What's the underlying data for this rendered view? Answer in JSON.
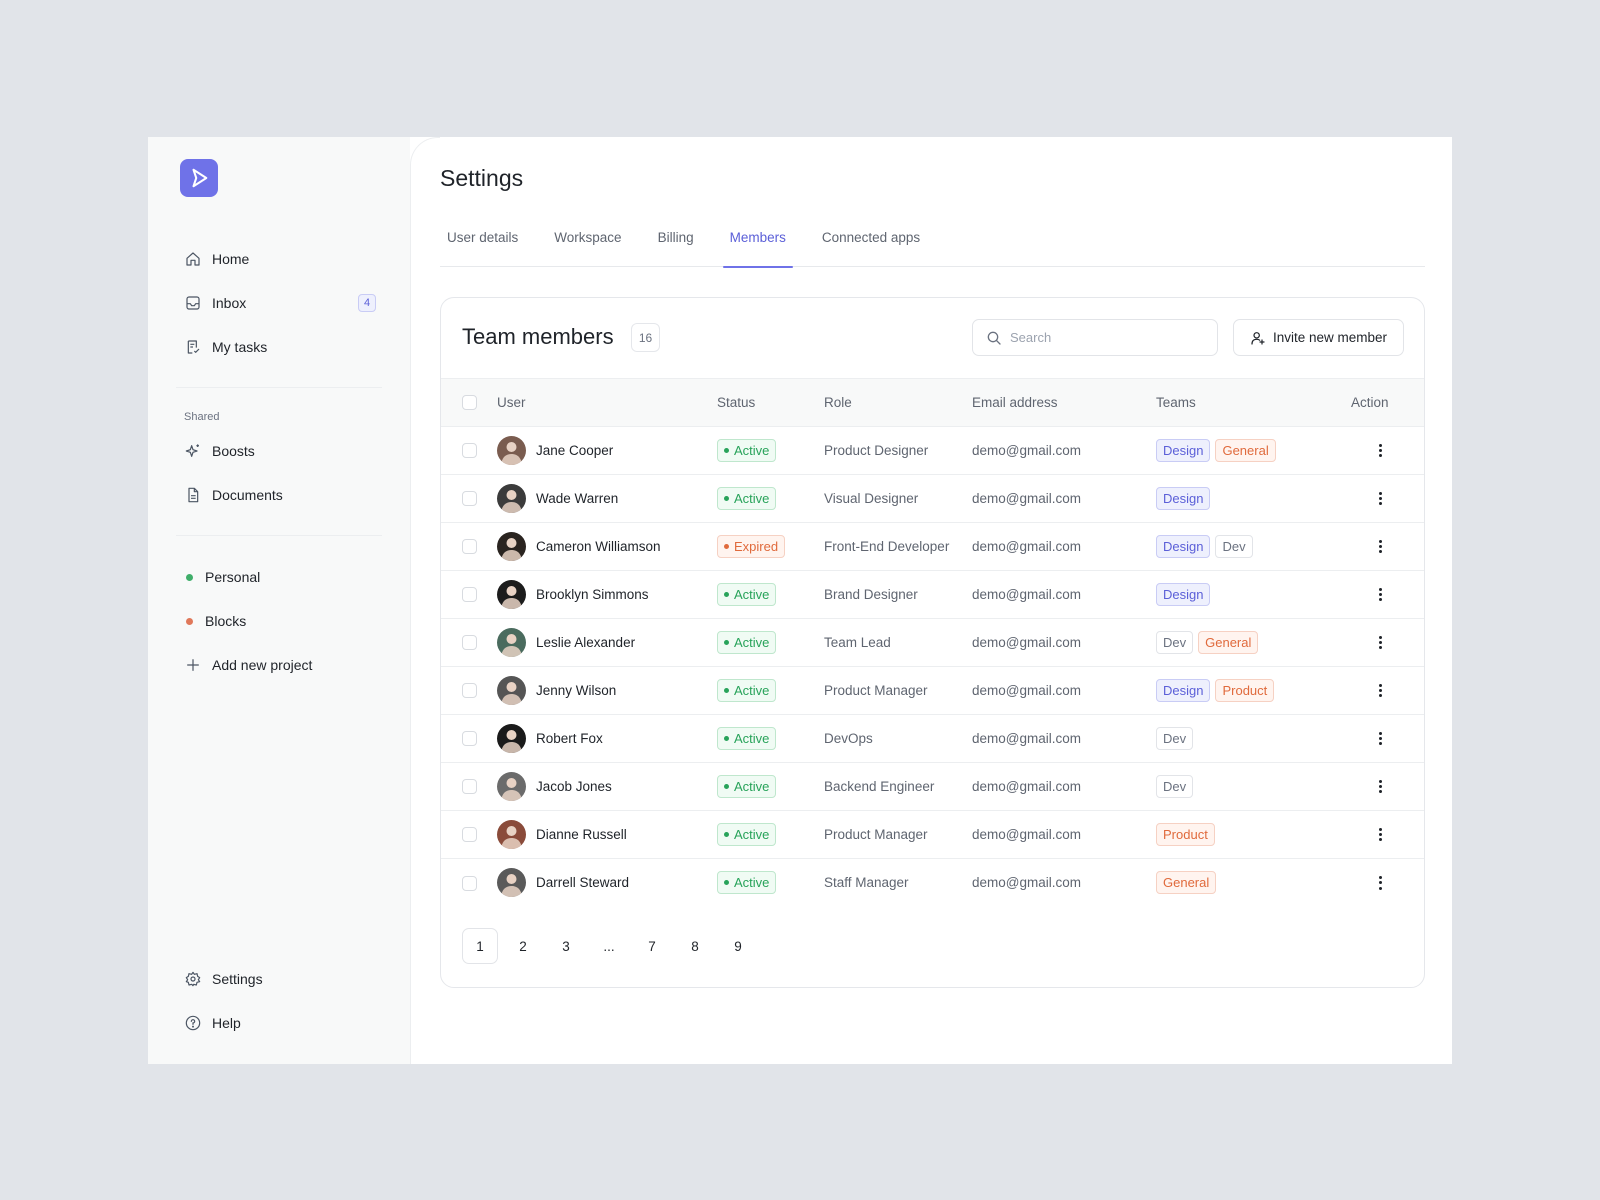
{
  "sidebar": {
    "nav": [
      {
        "label": "Home",
        "icon": "home-icon"
      },
      {
        "label": "Inbox",
        "icon": "inbox-icon",
        "badge": "4"
      },
      {
        "label": "My tasks",
        "icon": "tasks-icon"
      }
    ],
    "shared_label": "Shared",
    "shared": [
      {
        "label": "Boosts",
        "icon": "sparkle-icon"
      },
      {
        "label": "Documents",
        "icon": "document-icon"
      }
    ],
    "projects": [
      {
        "label": "Personal",
        "color": "#3fae6a"
      },
      {
        "label": "Blocks",
        "color": "#e0785a"
      }
    ],
    "add_project": "Add new project",
    "bottom": [
      {
        "label": "Settings",
        "icon": "gear-icon"
      },
      {
        "label": "Help",
        "icon": "help-icon"
      }
    ]
  },
  "page": {
    "title": "Settings",
    "tabs": [
      "User details",
      "Workspace",
      "Billing",
      "Members",
      "Connected apps"
    ],
    "active_tab": "Members"
  },
  "members": {
    "title": "Team members",
    "count": "16",
    "search_placeholder": "Search",
    "invite_label": "Invite new member",
    "columns": {
      "user": "User",
      "status": "Status",
      "role": "Role",
      "email": "Email address",
      "teams": "Teams",
      "action": "Action"
    },
    "rows": [
      {
        "name": "Jane Cooper",
        "status": "Active",
        "role": "Product Designer",
        "email": "demo@gmail.com",
        "teams": [
          "Design",
          "General"
        ]
      },
      {
        "name": "Wade Warren",
        "status": "Active",
        "role": "Visual Designer",
        "email": "demo@gmail.com",
        "teams": [
          "Design"
        ]
      },
      {
        "name": "Cameron Williamson",
        "status": "Expired",
        "role": "Front-End Developer",
        "email": "demo@gmail.com",
        "teams": [
          "Design",
          "Dev"
        ]
      },
      {
        "name": "Brooklyn Simmons",
        "status": "Active",
        "role": "Brand Designer",
        "email": "demo@gmail.com",
        "teams": [
          "Design"
        ]
      },
      {
        "name": "Leslie Alexander",
        "status": "Active",
        "role": "Team Lead",
        "email": "demo@gmail.com",
        "teams": [
          "Dev",
          "General"
        ]
      },
      {
        "name": "Jenny Wilson",
        "status": "Active",
        "role": "Product Manager",
        "email": "demo@gmail.com",
        "teams": [
          "Design",
          "Product"
        ]
      },
      {
        "name": "Robert Fox",
        "status": "Active",
        "role": "DevOps",
        "email": "demo@gmail.com",
        "teams": [
          "Dev"
        ]
      },
      {
        "name": "Jacob Jones",
        "status": "Active",
        "role": "Backend Engineer",
        "email": "demo@gmail.com",
        "teams": [
          "Dev"
        ]
      },
      {
        "name": "Dianne Russell",
        "status": "Active",
        "role": "Product Manager",
        "email": "demo@gmail.com",
        "teams": [
          "Product"
        ]
      },
      {
        "name": "Darrell Steward",
        "status": "Active",
        "role": "Staff Manager",
        "email": "demo@gmail.com",
        "teams": [
          "General"
        ]
      }
    ],
    "pagination": [
      "1",
      "2",
      "3",
      "...",
      "7",
      "8",
      "9"
    ],
    "current_page": "1"
  },
  "colors": {
    "accent": "#6f72e8",
    "active": "#28a35a",
    "expired": "#e06a3c"
  }
}
